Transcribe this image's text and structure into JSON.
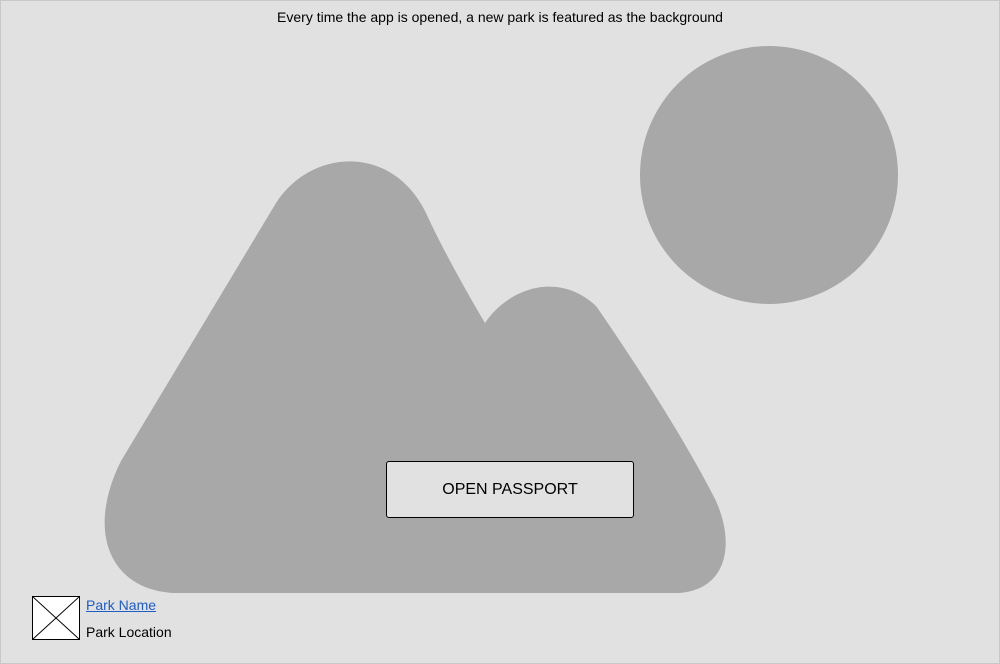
{
  "background": {
    "caption": "Every time the app is opened, a new park is featured as the background",
    "image_icon": "landscape-image-placeholder-icon"
  },
  "actions": {
    "open_passport_label": "OPEN PASSPORT"
  },
  "featured_park": {
    "thumbnail_icon": "image-placeholder-icon",
    "name": "Park Name",
    "location": "Park Location"
  },
  "colors": {
    "canvas": "#e1e1e1",
    "placeholder_shape": "#a8a8a8",
    "link": "#1f5cc4"
  }
}
